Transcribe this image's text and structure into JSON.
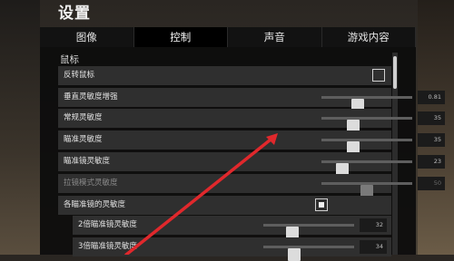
{
  "title": "设置",
  "tabs": [
    "图像",
    "控制",
    "声音",
    "游戏内容"
  ],
  "active_tab_index": 1,
  "section_title": "鼠标",
  "rows": [
    {
      "label": "反转鼠标",
      "type": "checkbox",
      "checked": false
    },
    {
      "label": "垂直灵敏度增强",
      "type": "slider",
      "value": "0.81",
      "fraction": 0.4
    },
    {
      "label": "常规灵敏度",
      "type": "slider",
      "value": "35",
      "fraction": 0.35
    },
    {
      "label": "瞄准灵敏度",
      "type": "slider",
      "value": "35",
      "fraction": 0.35
    },
    {
      "label": "瞄准镜灵敏度",
      "type": "slider",
      "value": "23",
      "fraction": 0.23
    },
    {
      "label": "拉镜模式灵敏度",
      "type": "slider",
      "value": "50",
      "fraction": 0.5,
      "disabled": true
    },
    {
      "label": "各瞄准镜的灵敏度",
      "type": "checkbox",
      "checked": true
    },
    {
      "label": "2倍瞄准镜灵敏度",
      "type": "slider",
      "value": "32",
      "fraction": 0.32,
      "indent": true
    },
    {
      "label": "3倍瞄准镜灵敏度",
      "type": "slider",
      "value": "34",
      "fraction": 0.34,
      "indent": true
    }
  ],
  "colors": {
    "annotation_arrow": "#e0282c",
    "panel": "#0c0c0c",
    "row": "#2f2f2f"
  }
}
